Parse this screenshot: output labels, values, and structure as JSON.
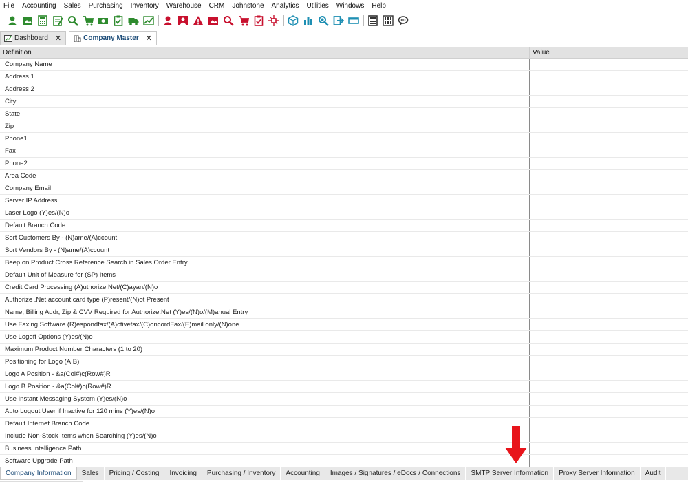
{
  "menu": [
    "File",
    "Accounting",
    "Sales",
    "Purchasing",
    "Inventory",
    "Warehouse",
    "CRM",
    "Johnstone",
    "Analytics",
    "Utilities",
    "Windows",
    "Help"
  ],
  "toolbar": {
    "icons": [
      "user-icon",
      "image-icon",
      "calculator-icon",
      "notepad-icon",
      "search-icon",
      "cart-icon",
      "money-icon",
      "clipboard-check-icon",
      "truck-icon",
      "trend-chart-icon",
      "user-icon",
      "portrait-icon",
      "warning-icon",
      "image-icon",
      "search-icon",
      "cart-icon",
      "clipboard-check-icon",
      "network-icon",
      "cube-icon",
      "bar-chart-icon",
      "magnify-icon",
      "export-icon",
      "window-icon",
      "calculator-icon",
      "abacus-icon",
      "chat-icon"
    ],
    "colors": {
      "green": "#2e8b2e",
      "red": "#c8102e",
      "teal": "#1e8fb3",
      "dark": "#333333"
    }
  },
  "doc_tabs": [
    {
      "label": "Dashboard",
      "icon": "chart-icon",
      "active": false
    },
    {
      "label": "Company Master",
      "icon": "building-icon",
      "active": true
    }
  ],
  "grid": {
    "columns": {
      "definition": "Definition",
      "value": "Value"
    },
    "rows": [
      "Company Name",
      "Address 1",
      "Address 2",
      "City",
      "State",
      "Zip",
      "Phone1",
      "Fax",
      "Phone2",
      "Area Code",
      "Company Email",
      "Server IP Address",
      "Laser Logo (Y)es/(N)o",
      "Default Branch Code",
      "Sort Customers By - (N)ame/(A)ccount",
      "Sort Vendors By - (N)ame/(A)ccount",
      "Beep on Product Cross Reference Search in Sales Order Entry",
      "Default Unit of Measure for (SP) Items",
      "Credit Card Processing (A)uthorize.Net/(C)ayan/(N)o",
      "Authorize .Net account card type (P)resent/(N)ot Present",
      "Name, Billing Addr, Zip & CVV Required for Authorize.Net (Y)es/(N)o/(M)anual Entry",
      "Use Faxing Software (R)espondfax/(A)ctivefax/(C)oncordFax/(E)mail only/(N)one",
      "Use Logoff Options (Y)es/(N)o",
      "Maximum Product Number Characters (1 to 20)",
      "Positioning for Logo (A,B)",
      "Logo A Position - &a(Col#)c(Row#)R",
      "Logo B Position - &a(Col#)c(Row#)R",
      "Use Instant Messaging System (Y)es/(N)o",
      "Auto Logout User if Inactive for 120 mins (Y)es/(N)o",
      "Default Internet Branch Code",
      "Include Non-Stock Items when Searching (Y)es/(N)o",
      "Business Intelligence Path",
      "Software Upgrade Path"
    ]
  },
  "bottom_tabs": [
    {
      "label": "Company Information",
      "active": true
    },
    {
      "label": "Sales",
      "active": false
    },
    {
      "label": "Pricing / Costing",
      "active": false
    },
    {
      "label": "Invoicing",
      "active": false
    },
    {
      "label": "Purchasing / Inventory",
      "active": false
    },
    {
      "label": "Accounting",
      "active": false
    },
    {
      "label": "Images / Signatures / eDocs / Connections",
      "active": false
    },
    {
      "label": "SMTP Server Information",
      "active": false
    },
    {
      "label": "Proxy Server Information",
      "active": false
    },
    {
      "label": "Audit",
      "active": false
    }
  ],
  "annotation": {
    "icon": "red-down-arrow-icon",
    "color": "#e8141b"
  }
}
